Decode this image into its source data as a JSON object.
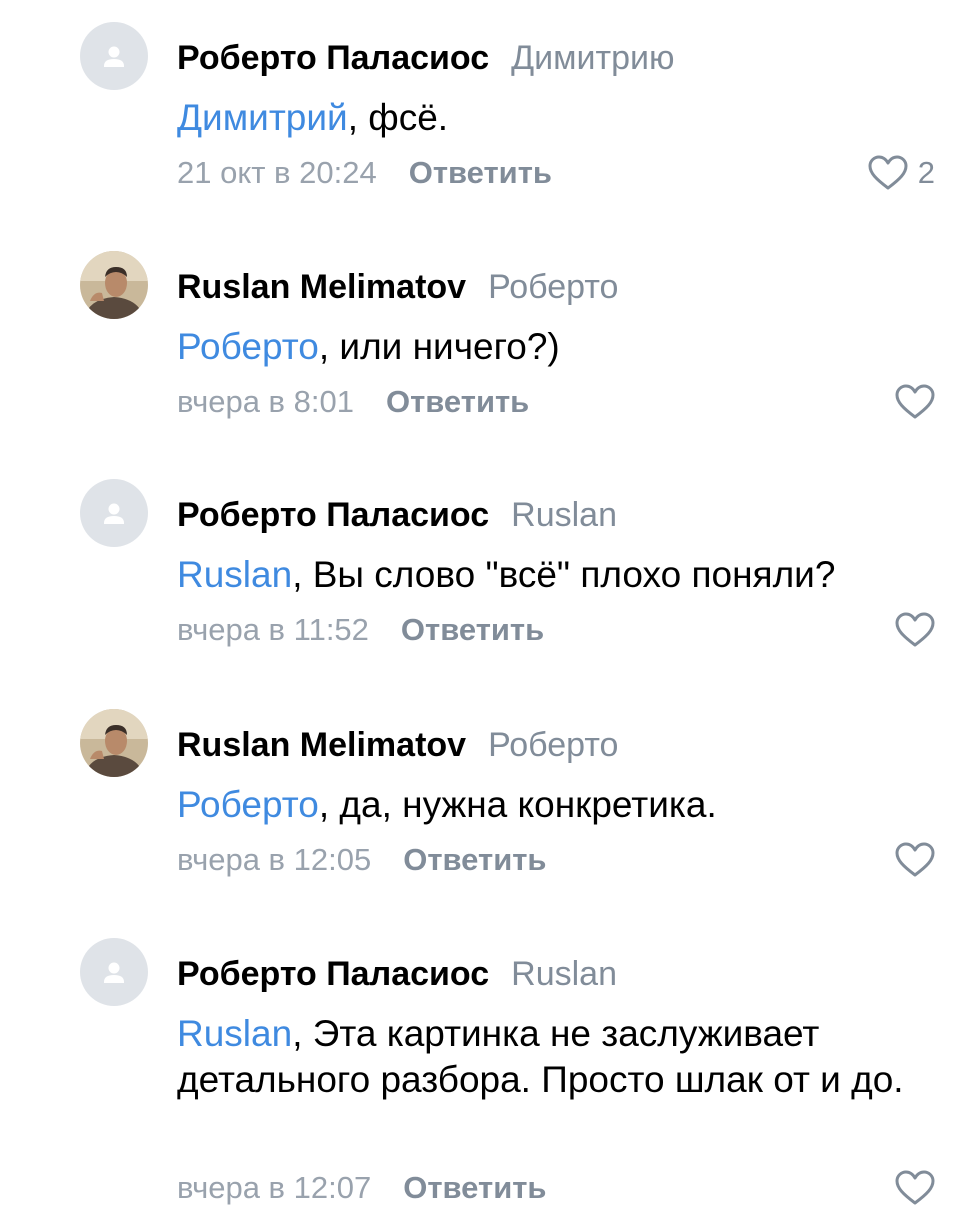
{
  "comments": [
    {
      "author": "Роберто Паласиос",
      "reply_to": "Димитрию",
      "mention": "Димитрий",
      "text": ", фсё.",
      "time": "21 окт в 20:24",
      "reply_label": "Ответить",
      "likes": "2",
      "avatar": "placeholder"
    },
    {
      "author": "Ruslan Melimatov",
      "reply_to": "Роберто",
      "mention": "Роберто",
      "text": ", или ничего?)",
      "time": "вчера в 8:01",
      "reply_label": "Ответить",
      "avatar": "photo"
    },
    {
      "author": "Роберто Паласиос",
      "reply_to": "Ruslan",
      "mention": "Ruslan",
      "text": ", Вы слово \"всё\" плохо поняли?",
      "time": "вчера в 11:52",
      "reply_label": "Ответить",
      "avatar": "placeholder"
    },
    {
      "author": "Ruslan Melimatov",
      "reply_to": "Роберто",
      "mention": "Роберто",
      "text": ", да, нужна конкретика.",
      "time": "вчера в 12:05",
      "reply_label": "Ответить",
      "avatar": "photo"
    },
    {
      "author": "Роберто Паласиос",
      "reply_to": "Ruslan",
      "mention": "Ruslan",
      "text": ", Эта картинка не заслуживает детального разбора. Просто шлак от и до.",
      "time": "вчера в 12:07",
      "reply_label": "Ответить",
      "avatar": "placeholder"
    }
  ],
  "icons": {
    "like": "heart-outline-icon",
    "avatar_placeholder": "user-silhouette-icon"
  },
  "colors": {
    "mention": "#3f8ae0",
    "secondary": "#818c99",
    "timestamp": "#99a2ad",
    "avatar_bg": "#dfe3e8"
  }
}
